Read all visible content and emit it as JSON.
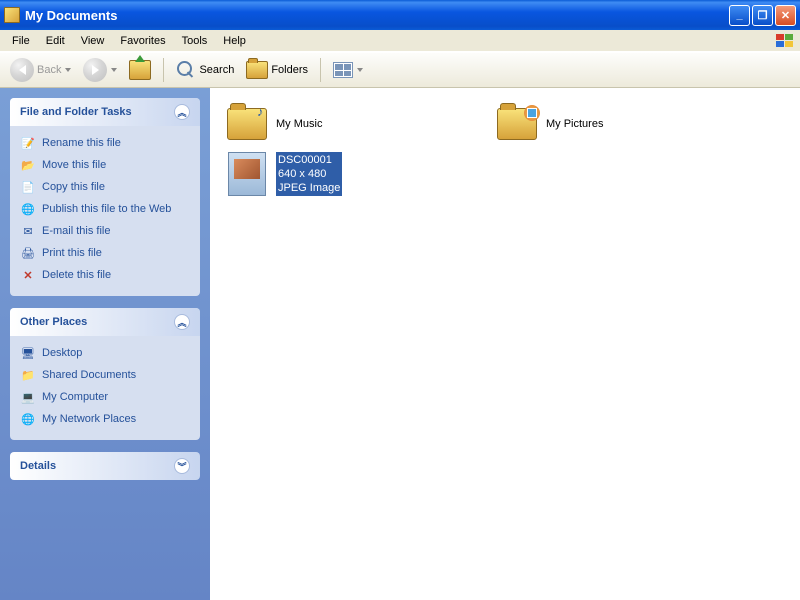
{
  "window": {
    "title": "My Documents"
  },
  "menu": {
    "items": [
      "File",
      "Edit",
      "View",
      "Favorites",
      "Tools",
      "Help"
    ]
  },
  "toolbar": {
    "back": "Back",
    "search": "Search",
    "folders": "Folders"
  },
  "side": {
    "tasks": {
      "title": "File and Folder Tasks",
      "items": [
        {
          "icon": "rename",
          "label": "Rename this file"
        },
        {
          "icon": "move",
          "label": "Move this file"
        },
        {
          "icon": "copy",
          "label": "Copy this file"
        },
        {
          "icon": "web",
          "label": "Publish this file to the Web"
        },
        {
          "icon": "mail",
          "label": "E-mail this file"
        },
        {
          "icon": "print",
          "label": "Print this file"
        },
        {
          "icon": "delete",
          "label": "Delete this file"
        }
      ]
    },
    "places": {
      "title": "Other Places",
      "items": [
        {
          "icon": "desktop",
          "label": "Desktop"
        },
        {
          "icon": "shared",
          "label": "Shared Documents"
        },
        {
          "icon": "computer",
          "label": "My Computer"
        },
        {
          "icon": "network",
          "label": "My Network Places"
        }
      ]
    },
    "details": {
      "title": "Details"
    }
  },
  "files": {
    "music": {
      "label": "My Music"
    },
    "pictures": {
      "label": "My Pictures"
    },
    "img": {
      "name": "DSC00001",
      "dims": "640 x 480",
      "type": "JPEG Image"
    }
  }
}
